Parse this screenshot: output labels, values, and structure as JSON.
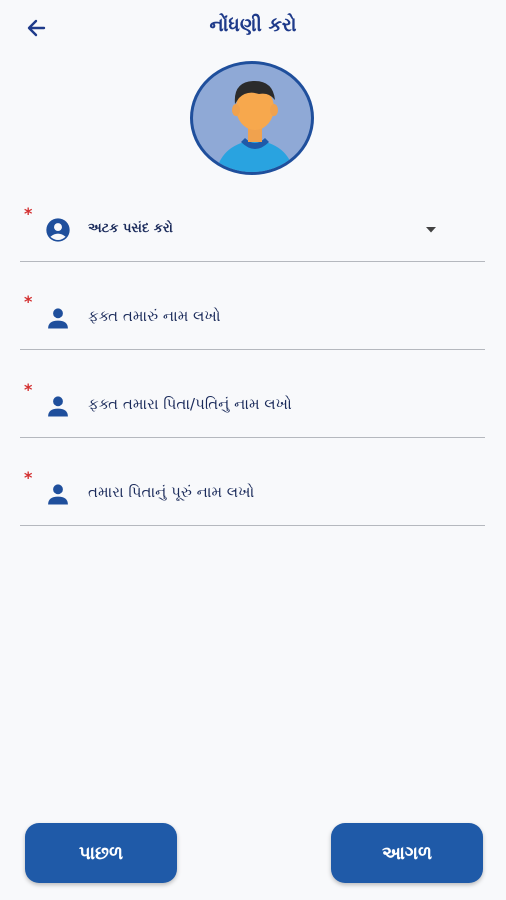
{
  "header": {
    "title": "નોંધણી કરો"
  },
  "form": {
    "caste": {
      "required_mark": "*",
      "placeholder": "અટક પસંદ કરો"
    },
    "first_name": {
      "required_mark": "*",
      "placeholder": "ફક્ત તમારું નામ લખો"
    },
    "father_name": {
      "required_mark": "*",
      "placeholder": "ફક્ત તમારા પિતા/પતિનું નામ લખો"
    },
    "father_full_name": {
      "required_mark": "*",
      "placeholder": "તમારા પિતાનું પૂરું નામ લખો"
    }
  },
  "footer": {
    "back_label": "પાછળ",
    "next_label": "આગળ"
  },
  "colors": {
    "primary": "#1f5aa8",
    "title": "#1e3a8a",
    "required": "#d32f2f",
    "background": "#f8f9fb"
  },
  "icons": {
    "back": "arrow-left-icon",
    "avatar": "user-avatar",
    "caste": "account-circle-icon",
    "person": "person-icon",
    "dropdown": "caret-down-icon"
  }
}
